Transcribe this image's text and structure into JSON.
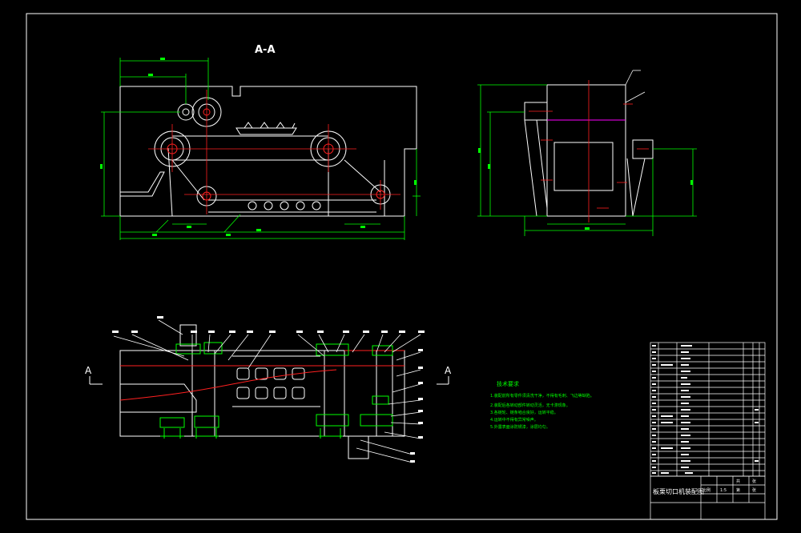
{
  "drawing": {
    "section_label": "A-A",
    "cut_marker_left": "A",
    "cut_marker_right": "A"
  },
  "tech_notes": {
    "title": "技术要求",
    "lines": [
      "1.装配前所有零件须清洗干净，不得有毛刺、飞边等缺陷。",
      "2.装配后各转动部件转动灵活，无卡滞现象。",
      "3.各链轮、链条啮合良好，运转平稳。",
      "4.运转中不得有异常噪声。",
      "5.外露表面涂防锈漆，涂层均匀。"
    ]
  },
  "title_block": {
    "name": "板栗切口机装配图",
    "cells": [
      "比例",
      "1:5",
      "共",
      "张",
      "第",
      "张"
    ]
  },
  "colors": {
    "background": "#000000",
    "outline": "#ffffff",
    "dimension": "#00ff00",
    "centerline": "#ff2020",
    "hidden": "#ff00ff",
    "text_notes": "#00ff00"
  }
}
